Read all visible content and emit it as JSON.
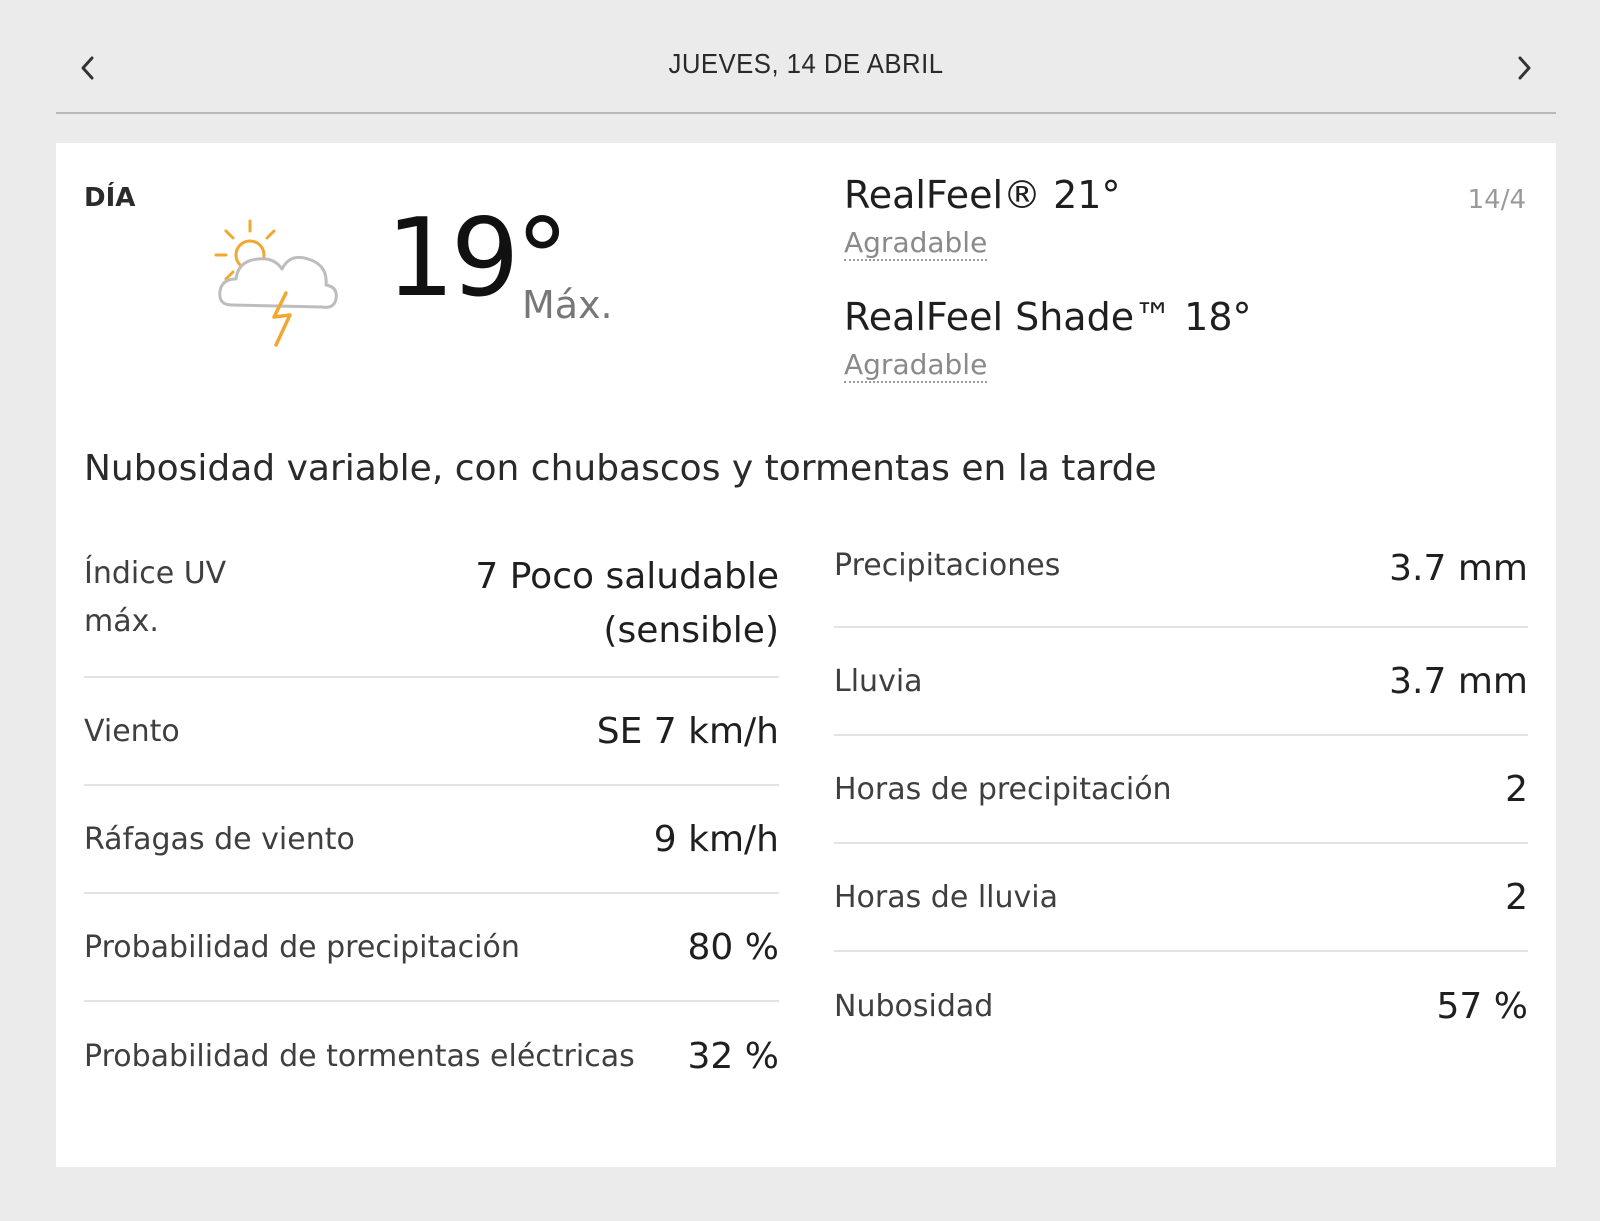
{
  "nav": {
    "title": "JUEVES, 14 DE ABRIL",
    "prev_icon": "chevron-left-icon",
    "next_icon": "chevron-right-icon"
  },
  "day": {
    "label": "DÍA",
    "icon": "partly-cloudy-thunderstorm-icon",
    "temperature": "19°",
    "temperature_suffix": "Máx.",
    "realfeel": "RealFeel® 21°",
    "realfeel_phrase": "Agradable",
    "realfeel_shade": "RealFeel Shade™ 18°",
    "realfeel_shade_phrase": "Agradable",
    "date_short": "14/4",
    "phrase": "Nubosidad variable, con chubascos y tormentas en la tarde"
  },
  "details_left": {
    "uv_label_line1": "Índice UV",
    "uv_label_line2": "máx.",
    "uv_value_line1": "7 Poco saludable",
    "uv_value_line2": "(sensible)",
    "wind_label": "Viento",
    "wind_value": "SE 7 km/h",
    "gusts_label": "Ráfagas de viento",
    "gusts_value": "9 km/h",
    "precip_prob_label": "Probabilidad de precipitación",
    "precip_prob_value": "80 %",
    "thunder_prob_label": "Probabilidad de tormentas eléctricas",
    "thunder_prob_value": "32 %"
  },
  "details_right": {
    "precip_label": "Precipitaciones",
    "precip_value": "3.7 mm",
    "rain_label": "Lluvia",
    "rain_value": "3.7 mm",
    "precip_hours_label": "Horas de precipitación",
    "precip_hours_value": "2",
    "rain_hours_label": "Horas de lluvia",
    "rain_hours_value": "2",
    "cloud_label": "Nubosidad",
    "cloud_value": "57 %"
  },
  "colors": {
    "background": "#ebebeb",
    "card": "#ffffff",
    "sun": "#f0a830",
    "bolt": "#f0a830"
  }
}
